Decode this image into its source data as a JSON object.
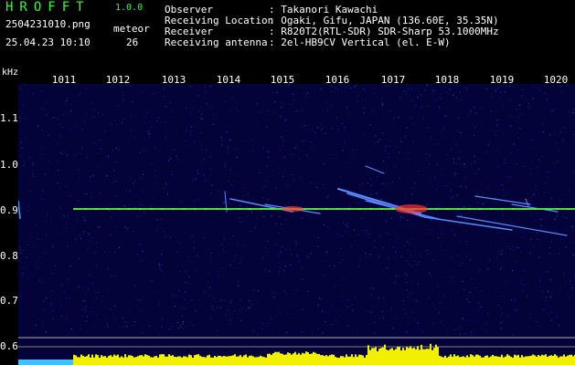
{
  "app": {
    "title": "HROFFT",
    "version": "1.0.0"
  },
  "image_info": {
    "filename": "2504231010.png",
    "datetime": "25.04.23 10:10",
    "meteor_label": "meteor",
    "meteor_count": "26"
  },
  "station": [
    {
      "label": "Observer",
      "value": ": Takanori Kawachi"
    },
    {
      "label": "Receiving Location",
      "value": ": Ogaki, Gifu, JAPAN (136.60E, 35.35N)"
    },
    {
      "label": "Receiver",
      "value": ": R820T2(RTL-SDR) SDR-Sharp 53.1000MHz"
    },
    {
      "label": "Receiving antenna",
      "value": ": 2el-HB9CV Vertical (el. E-W)"
    }
  ],
  "axis": {
    "unit": "kHz",
    "freq_ticks": [
      "1011",
      "1012",
      "1013",
      "1014",
      "1015",
      "1016",
      "1017",
      "1018",
      "1019",
      "1020"
    ],
    "y_ticks": [
      "1.1",
      "1.0",
      "0.9",
      "0.8",
      "0.7",
      "0.6"
    ]
  },
  "colors": {
    "header_green": "#30ff30",
    "background": "#03033a",
    "carrier": "#40e040",
    "echo": "#5080ff",
    "noise_bar": "#f0f000",
    "noise_low": "#40c0ff"
  }
}
